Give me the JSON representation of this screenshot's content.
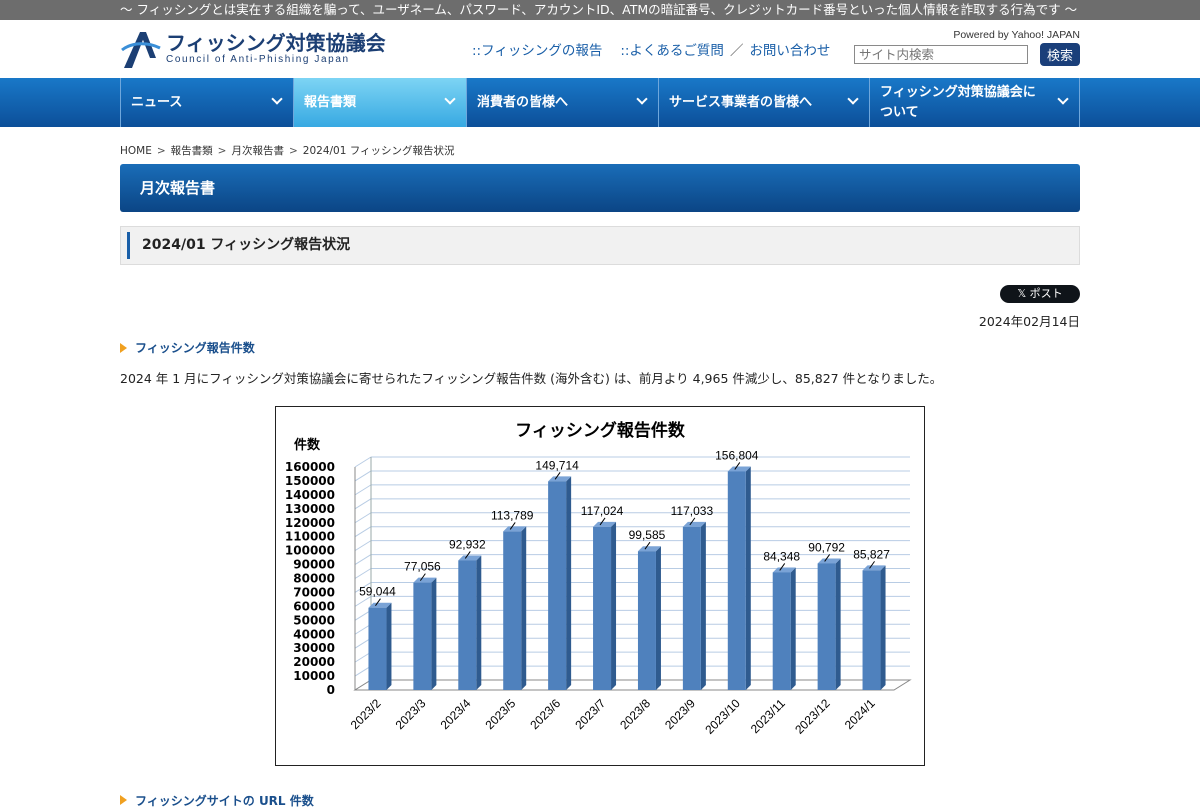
{
  "topbar": {
    "text": "〜 フィッシングとは実在する組織を騙って、ユーザネーム、パスワード、アカウントID、ATMの暗証番号、クレジットカード番号といった個人情報を詐取する行為です 〜"
  },
  "header": {
    "logo_title": "フィッシング対策協議会",
    "logo_sub": "Council of Anti-Phishing Japan",
    "links": [
      "::フィッシングの報告",
      "::よくあるご質問",
      "お問い合わせ"
    ],
    "link_sep": "／",
    "powered": "Powered by Yahoo! JAPAN",
    "search_placeholder": "サイト内検索",
    "search_button": "検索"
  },
  "nav": [
    {
      "label": "ニュース"
    },
    {
      "label": "報告書類"
    },
    {
      "label": "消費者の皆様へ"
    },
    {
      "label": "サービス事業者の皆様へ"
    },
    {
      "label": "フィッシング対策協議会について"
    }
  ],
  "breadcrumb": [
    "HOME",
    "報告書類",
    "月次報告書",
    "2024/01 フィッシング報告状況"
  ],
  "breadcrumb_sep": ">",
  "page_title": "月次報告書",
  "subtitle": "2024/01 フィッシング報告状況",
  "post_button": "𝕏 ポスト",
  "date": "2024年02月14日",
  "section1": "フィッシング報告件数",
  "paragraph": "2024 年 1 月にフィッシング対策協議会に寄せられたフィッシング報告件数 (海外含む) は、前月より 4,965 件減少し、85,827 件となりました。",
  "section2": "フィッシングサイトの URL 件数",
  "colors": {
    "bar": "#4f81bd",
    "bar_top": "#7aa3d6",
    "bar_side": "#2f5b8f",
    "nav": "#0c4f99",
    "accent": "#f0a020"
  },
  "chart_data": {
    "type": "bar",
    "title": "フィッシング報告件数",
    "ylabel": "件数",
    "xlabel": "",
    "categories": [
      "2023/2",
      "2023/3",
      "2023/4",
      "2023/5",
      "2023/6",
      "2023/7",
      "2023/8",
      "2023/9",
      "2023/10",
      "2023/11",
      "2023/12",
      "2024/1"
    ],
    "values": [
      59044,
      77056,
      92932,
      113789,
      149714,
      117024,
      99585,
      117033,
      156804,
      84348,
      90792,
      85827
    ],
    "value_labels": [
      "59,044",
      "77,056",
      "92,932",
      "113,789",
      "149,714",
      "117,024",
      "99,585",
      "117,033",
      "156,804",
      "84,348",
      "90,792",
      "85,827"
    ],
    "ylim": [
      0,
      160000
    ],
    "yticks": [
      0,
      10000,
      20000,
      30000,
      40000,
      50000,
      60000,
      70000,
      80000,
      90000,
      100000,
      110000,
      120000,
      130000,
      140000,
      150000,
      160000
    ],
    "grid": true,
    "legend": "none"
  }
}
